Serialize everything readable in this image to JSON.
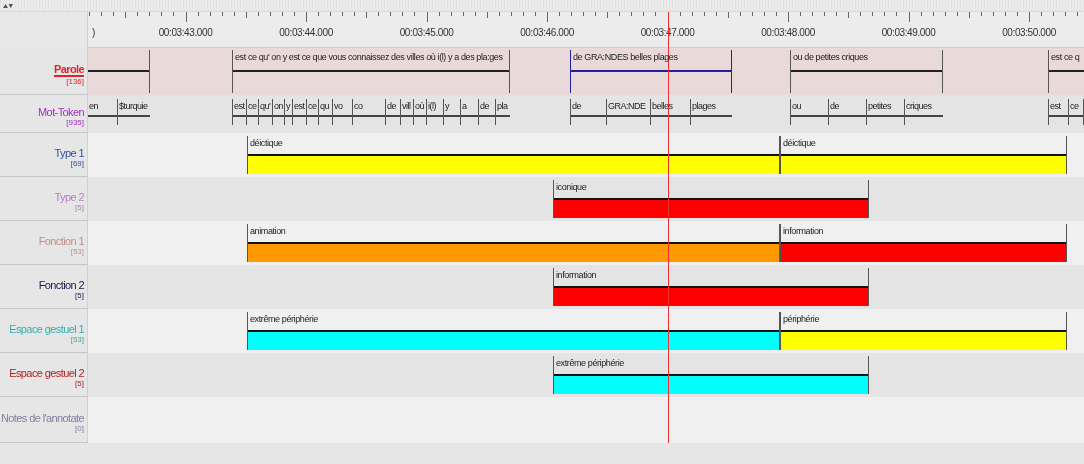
{
  "ruler": {
    "cut_label": ")",
    "labels": [
      "00:03:43.000",
      "00:03:44.000",
      "00:03:45.000",
      "00:03:46.000",
      "00:03:47.000",
      "00:03:48.000",
      "00:03:49.000",
      "00:03:50.000"
    ]
  },
  "tiers": [
    {
      "name": "Parole",
      "count": "[136]",
      "kind": "speech",
      "color": "#e0242a",
      "active": true,
      "annotations": [
        {
          "selected": false
        },
        {
          "text": "est ce qu' on y est ce que vous connaissez des villes où i(l) y a des pla:ges",
          "selected": false
        },
        {
          "text": "de GRA:NDES belles plages",
          "selected": true
        },
        {
          "text": "ou de petites criques",
          "selected": false
        },
        {
          "text": "est ce q",
          "selected": false
        }
      ]
    },
    {
      "name": "Mot-Token",
      "count": "[935]",
      "kind": "tokens",
      "color": "#a030c0",
      "active": false,
      "annotations": [
        {
          "text": "en"
        },
        {
          "text": "$turquie"
        },
        {
          "text": "est"
        },
        {
          "text": "ce"
        },
        {
          "text": "qu'"
        },
        {
          "text": "on"
        },
        {
          "text": "y"
        },
        {
          "text": "est"
        },
        {
          "text": "ce"
        },
        {
          "text": "qu"
        },
        {
          "text": "vo"
        },
        {
          "text": "co"
        },
        {
          "text": "de"
        },
        {
          "text": "vill"
        },
        {
          "text": "où"
        },
        {
          "text": "i(l)"
        },
        {
          "text": "y"
        },
        {
          "text": "a"
        },
        {
          "text": "de"
        },
        {
          "text": "pla"
        },
        {
          "text": "de"
        },
        {
          "text": "GRA:NDE"
        },
        {
          "text": "belles"
        },
        {
          "text": "plages"
        },
        {
          "text": "ou"
        },
        {
          "text": "de"
        },
        {
          "text": "petites"
        },
        {
          "text": "criques"
        },
        {
          "text": "est"
        },
        {
          "text": "ce"
        }
      ]
    },
    {
      "name": "Type 1",
      "count": "[69]",
      "kind": "gesture",
      "color": "#3050a0",
      "active": false,
      "annotations": [
        {
          "text": "déictique",
          "color": "#ffff00"
        },
        {
          "text": "déictique",
          "color": "#ffff00"
        }
      ]
    },
    {
      "name": "Type 2",
      "count": "[5]",
      "kind": "gesture",
      "color": "#b080c0",
      "active": false,
      "annotations": [
        {
          "text": "iconique",
          "color": "#ff0000"
        }
      ]
    },
    {
      "name": "Fonction 1",
      "count": "[53]",
      "kind": "gesture",
      "color": "#c09090",
      "active": false,
      "annotations": [
        {
          "text": "animation",
          "color": "#ff9900"
        },
        {
          "text": "information",
          "color": "#ff0000"
        }
      ]
    },
    {
      "name": "Fonction 2",
      "count": "[5]",
      "kind": "gesture",
      "color": "#202050",
      "active": false,
      "annotations": [
        {
          "text": "information",
          "color": "#ff0000"
        }
      ]
    },
    {
      "name": "Espace gestuel 1",
      "count": "[53]",
      "kind": "gesture",
      "color": "#30b0b0",
      "active": false,
      "annotations": [
        {
          "text": "extrême périphérie",
          "color": "#00ffff"
        },
        {
          "text": "périphérie",
          "color": "#ffff00"
        }
      ]
    },
    {
      "name": "Espace gestuel 2",
      "count": "[5]",
      "kind": "gesture",
      "color": "#b02020",
      "active": false,
      "annotations": [
        {
          "text": "extrême périphérie",
          "color": "#00ffff"
        }
      ]
    },
    {
      "name": "Notes de l'annotate",
      "count": "[0]",
      "kind": "notes",
      "color": "#8080a0",
      "active": false
    }
  ]
}
